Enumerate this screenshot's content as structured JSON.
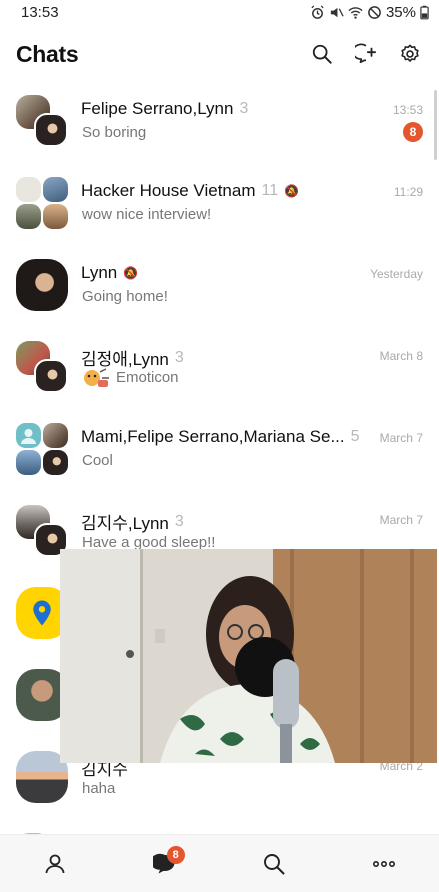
{
  "status_bar": {
    "time": "13:53",
    "battery": "35%"
  },
  "header": {
    "title": "Chats",
    "icons": [
      "search-icon",
      "new-chat-icon",
      "settings-icon"
    ]
  },
  "chats": [
    {
      "name": "Felipe Serrano,Lynn",
      "count": "3",
      "preview": "So boring",
      "time": "13:53",
      "unread": "8"
    },
    {
      "name": "Hacker House Vietnam",
      "count": "11",
      "muted": true,
      "preview": "wow nice interview!",
      "time": "11:29"
    },
    {
      "name": "Lynn",
      "muted": true,
      "preview": "Going home!",
      "time": "Yesterday"
    },
    {
      "name": "김정애,Lynn",
      "count": "3",
      "preview": "Emoticon",
      "time": "March 8"
    },
    {
      "name": "Mami,Felipe Serrano,Mariana Se...",
      "count": "5",
      "preview": "Cool",
      "time": "March 7"
    },
    {
      "name": "김지수,Lynn",
      "count": "3",
      "preview": "Have a good sleep!!",
      "time": "March 7"
    },
    {
      "name": "",
      "preview": "",
      "time": ""
    },
    {
      "name": "",
      "preview": "",
      "time": ""
    },
    {
      "name": "김지수",
      "preview": "haha",
      "time": "March 2"
    }
  ],
  "bottom_nav": {
    "items": [
      "friends-icon",
      "chats-icon",
      "search-icon",
      "more-icon"
    ],
    "chats_badge": "8"
  },
  "colors": {
    "badge": "#e4572e",
    "text": "#111111",
    "muted_text": "#777777"
  }
}
